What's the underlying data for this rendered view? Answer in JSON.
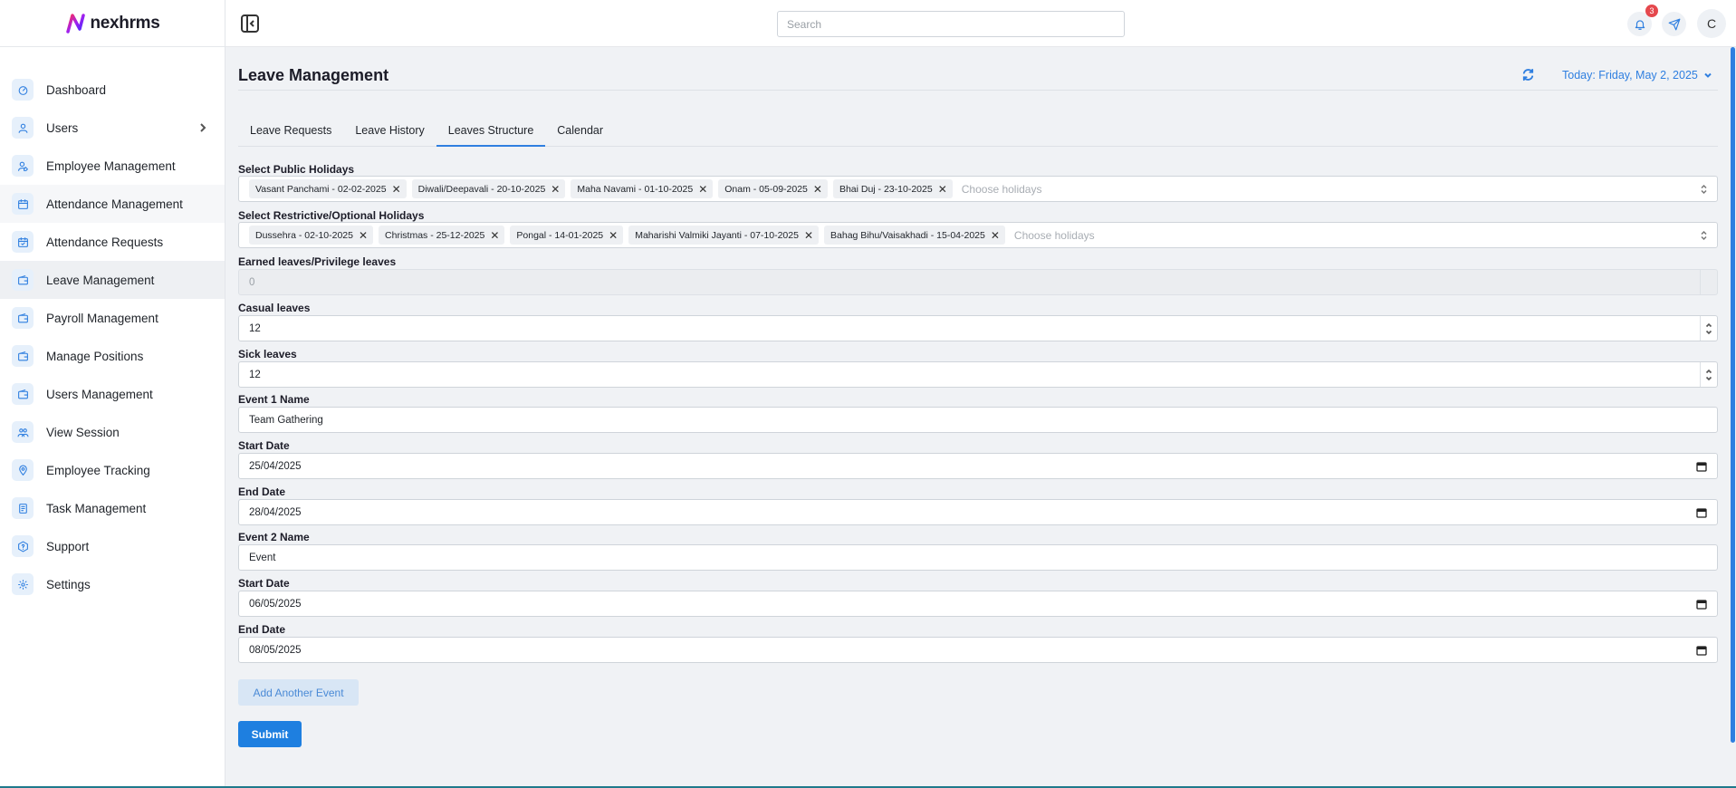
{
  "brand": {
    "name": "nexhrms"
  },
  "sidebar": {
    "items": [
      {
        "label": "Dashboard",
        "icon": "dashboard-icon"
      },
      {
        "label": "Users",
        "icon": "user-icon"
      },
      {
        "label": "Employee Management",
        "icon": "user-edit-icon"
      },
      {
        "label": "Attendance Management",
        "icon": "calendar-icon"
      },
      {
        "label": "Attendance Requests",
        "icon": "calendar-check-icon"
      },
      {
        "label": "Leave Management",
        "icon": "wallet-icon"
      },
      {
        "label": "Payroll Management",
        "icon": "wallet-icon"
      },
      {
        "label": "Manage Positions",
        "icon": "wallet-icon"
      },
      {
        "label": "Users Management",
        "icon": "wallet-icon"
      },
      {
        "label": "View Session",
        "icon": "users-icon"
      },
      {
        "label": "Employee Tracking",
        "icon": "location-icon"
      },
      {
        "label": "Task Management",
        "icon": "task-icon"
      },
      {
        "label": "Support",
        "icon": "help-icon"
      },
      {
        "label": "Settings",
        "icon": "gear-icon"
      }
    ]
  },
  "header": {
    "search_placeholder": "Search",
    "notification_count": "3",
    "avatar_initial": "C"
  },
  "page": {
    "title": "Leave Management",
    "today": "Today: Friday, May 2, 2025"
  },
  "tabs": [
    {
      "label": "Leave Requests"
    },
    {
      "label": "Leave History"
    },
    {
      "label": "Leaves Structure"
    },
    {
      "label": "Calendar"
    }
  ],
  "form": {
    "public_holidays": {
      "label": "Select Public Holidays",
      "chips": [
        "Vasant Panchami - 02-02-2025",
        "Diwali/Deepavali - 20-10-2025",
        "Maha Navami - 01-10-2025",
        "Onam - 05-09-2025",
        "Bhai Duj - 23-10-2025"
      ],
      "placeholder": "Choose holidays"
    },
    "restrictive_holidays": {
      "label": "Select Restrictive/Optional Holidays",
      "chips": [
        "Dussehra - 02-10-2025",
        "Christmas - 25-12-2025",
        "Pongal - 14-01-2025",
        "Maharishi Valmiki Jayanti - 07-10-2025",
        "Bahag Bihu/Vaisakhadi - 15-04-2025"
      ],
      "placeholder": "Choose holidays"
    },
    "earned_leaves": {
      "label": "Earned leaves/Privilege leaves",
      "value": "0"
    },
    "casual_leaves": {
      "label": "Casual leaves",
      "value": "12"
    },
    "sick_leaves": {
      "label": "Sick leaves",
      "value": "12"
    },
    "event1_name": {
      "label": "Event 1 Name",
      "value": "Team Gathering"
    },
    "event1_start": {
      "label": "Start Date",
      "value": "25/04/2025"
    },
    "event1_end": {
      "label": "End Date",
      "value": "28/04/2025"
    },
    "event2_name": {
      "label": "Event 2 Name",
      "value": "Event"
    },
    "event2_start": {
      "label": "Start Date",
      "value": "06/05/2025"
    },
    "event2_end": {
      "label": "End Date",
      "value": "08/05/2025"
    },
    "add_event_label": "Add Another Event",
    "submit_label": "Submit"
  },
  "colors": {
    "accent": "#2f7fe0",
    "badge": "#e5484d",
    "background": "#f0f2f5"
  }
}
